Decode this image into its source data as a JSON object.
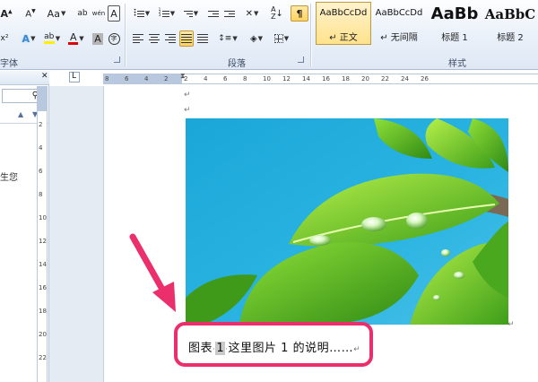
{
  "ribbon": {
    "font_group_label": "字体",
    "paragraph_group_label": "段落",
    "styles_group_label": "样式",
    "font_buttons": {
      "grow": "A",
      "shrink": "A",
      "change_case": "Aa",
      "clear_format": "ab",
      "phonetic": "wén",
      "border": "A",
      "text_effect": "A",
      "highlight": "ab",
      "font_color": "A",
      "char_shading": "A",
      "enclose": "字"
    },
    "styles": [
      {
        "sample": "AaBbCcDd",
        "name": "↵ 正文",
        "selected": true
      },
      {
        "sample": "AaBbCcDd",
        "name": "↵ 无间隔",
        "selected": false
      },
      {
        "sample": "AaBb",
        "name": "标题 1",
        "selected": false
      },
      {
        "sample": "AaBbC",
        "name": "标题 2",
        "selected": false
      }
    ]
  },
  "nav_pane": {
    "search_icon": "search-icon",
    "side_text": "生您"
  },
  "ruler": {
    "h_ticks": [
      "8",
      "6",
      "4",
      "2",
      "2",
      "4",
      "6",
      "8",
      "10",
      "12",
      "14",
      "16",
      "18",
      "20",
      "22",
      "24",
      "26"
    ],
    "v_ticks": [
      "2",
      "4",
      "6",
      "8",
      "10",
      "12",
      "14",
      "16",
      "18",
      "20",
      "22"
    ]
  },
  "document": {
    "caption": {
      "prefix": "图表",
      "number": "1",
      "text": "这里图片 1 的说明……"
    },
    "image_icon": "leaf-waterdrop-photo"
  },
  "colors": {
    "highlight_box": "#ea2f6c",
    "arrow": "#ea2f6c",
    "ribbon_bg": "#e9f0f9"
  }
}
